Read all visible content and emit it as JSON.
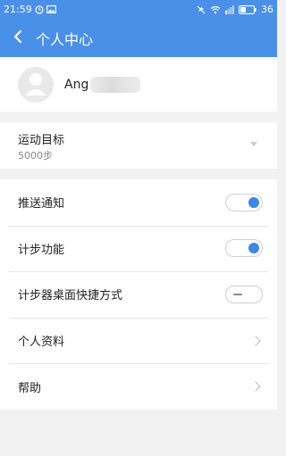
{
  "status_bar": {
    "time": "21:59",
    "battery": "36",
    "icons": [
      "alarm-icon",
      "image-icon",
      "mute-icon",
      "wifi-icon",
      "signal-icon",
      "battery-icon"
    ]
  },
  "app_bar": {
    "title": "个人中心",
    "back_icon": "chevron-left-icon",
    "background": "#4a90e8"
  },
  "profile": {
    "name": "Ang",
    "avatar_icon": "person-icon"
  },
  "goal": {
    "label": "运动目标",
    "value": "5000步"
  },
  "settings": {
    "push_notify": {
      "label": "推送通知",
      "enabled": true
    },
    "pedometer": {
      "label": "计步功能",
      "enabled": true
    },
    "desktop_shortcut": {
      "label": "计步器桌面快捷方式",
      "enabled": false
    },
    "profile_info": {
      "label": "个人资料"
    },
    "help": {
      "label": "帮助"
    }
  },
  "colors": {
    "accent": "#3f86e6",
    "page_background": "#f2f2f2"
  }
}
